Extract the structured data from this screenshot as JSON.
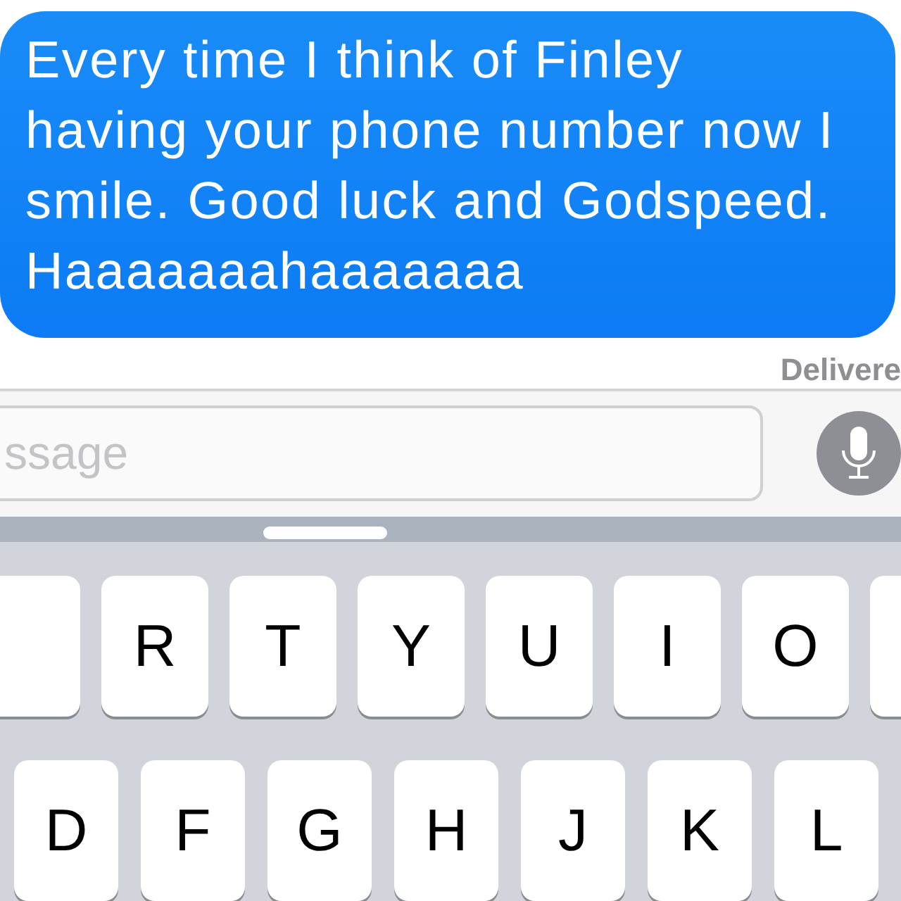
{
  "message": {
    "text": "Every time I think of Finley having your phone number now I smile. Good luck and Godspeed. Haaaaaaahaaaaaaa"
  },
  "status": "Delivere",
  "composer": {
    "placeholder": "ssage"
  },
  "keyboard": {
    "rows": [
      {
        "keys": [
          {
            "kind": "edge"
          },
          {
            "kind": "letter",
            "label": "R"
          },
          {
            "kind": "letter",
            "label": "T"
          },
          {
            "kind": "letter",
            "label": "Y"
          },
          {
            "kind": "letter",
            "label": "U"
          },
          {
            "kind": "letter",
            "label": "I"
          },
          {
            "kind": "letter",
            "label": "O"
          },
          {
            "kind": "edge"
          }
        ]
      },
      {
        "keys": [
          {
            "kind": "letter",
            "label": "D"
          },
          {
            "kind": "letter",
            "label": "F"
          },
          {
            "kind": "letter",
            "label": "G"
          },
          {
            "kind": "letter",
            "label": "H"
          },
          {
            "kind": "letter",
            "label": "J"
          },
          {
            "kind": "letter",
            "label": "K"
          },
          {
            "kind": "letter",
            "label": "L"
          }
        ]
      }
    ]
  }
}
